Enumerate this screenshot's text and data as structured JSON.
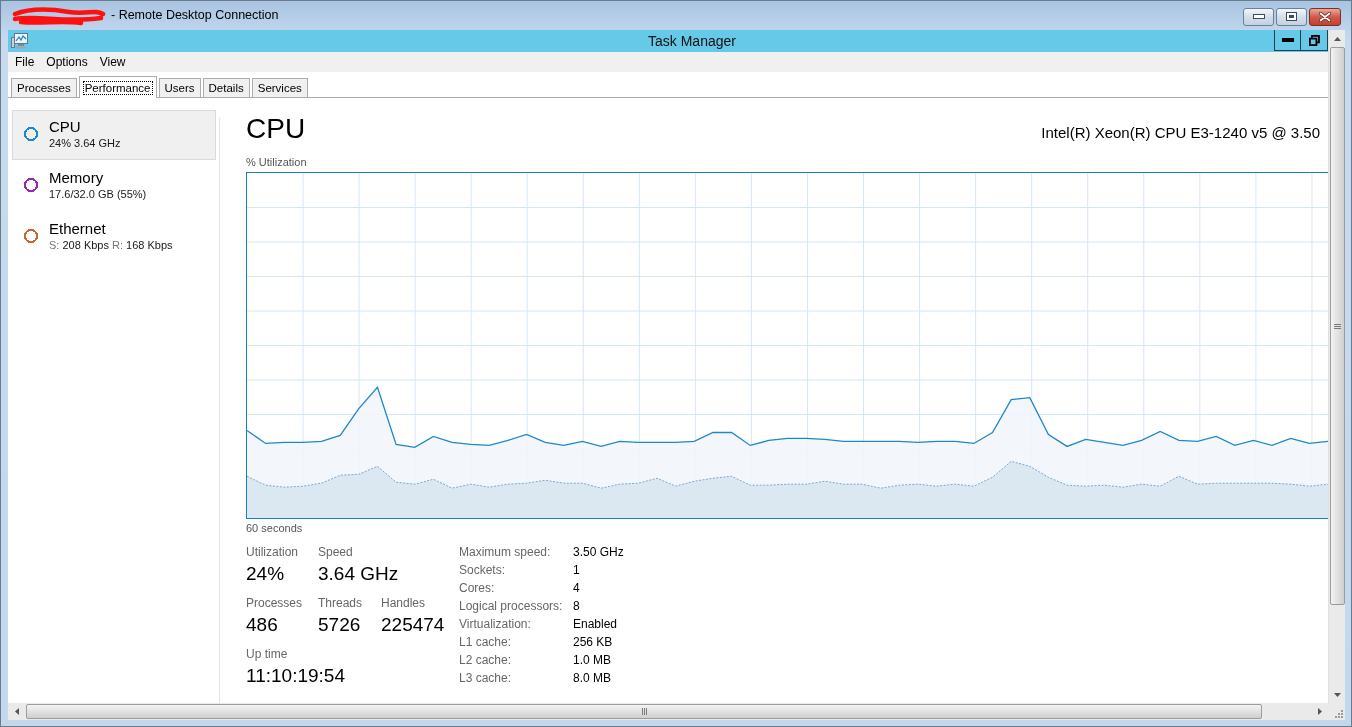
{
  "window": {
    "title": "- Remote Desktop Connection"
  },
  "app": {
    "title": "Task Manager"
  },
  "menu": [
    "File",
    "Options",
    "View"
  ],
  "tabs": [
    {
      "label": "Processes",
      "selected": false
    },
    {
      "label": "Performance",
      "selected": true
    },
    {
      "label": "Users",
      "selected": false
    },
    {
      "label": "Details",
      "selected": false
    },
    {
      "label": "Services",
      "selected": false
    }
  ],
  "sidebar": {
    "items": [
      {
        "name": "CPU",
        "reading": [
          {
            "value": "24% 3.64 GHz"
          }
        ],
        "selected": true,
        "color": "#1c88d4"
      },
      {
        "name": "Memory",
        "reading": [
          {
            "value": "17.6/32.0 GB (55%)"
          }
        ],
        "selected": false,
        "color": "#9a28ad"
      },
      {
        "name": "Ethernet",
        "reading": [
          {
            "label": "S:",
            "value": "208 Kbps"
          },
          {
            "label": "R:",
            "value": "168 Kbps"
          }
        ],
        "selected": false,
        "color": "#c9692b"
      }
    ]
  },
  "panel": {
    "title": "CPU",
    "processor": "Intel(R) Xeon(R) CPU E3-1240 v5 @ 3.50",
    "graph": {
      "label": "% Utilization",
      "time_span": "60 seconds"
    },
    "stat_rows": [
      [
        {
          "label": "Utilization",
          "value": "24%"
        },
        {
          "label": "Speed",
          "value": "3.64 GHz"
        }
      ],
      [
        {
          "label": "Processes",
          "value": "486"
        },
        {
          "label": "Threads",
          "value": "5726"
        },
        {
          "label": "Handles",
          "value": "225474"
        }
      ],
      [
        {
          "label": "Up time",
          "value": "11:10:19:54"
        }
      ]
    ],
    "details": [
      {
        "label": "Maximum speed:",
        "value": "3.50 GHz"
      },
      {
        "label": "Sockets:",
        "value": "1"
      },
      {
        "label": "Cores:",
        "value": "4"
      },
      {
        "label": "Logical processors:",
        "value": "8"
      },
      {
        "label": "Virtualization:",
        "value": "Enabled"
      },
      {
        "label": "L1 cache:",
        "value": "256 KB"
      },
      {
        "label": "L2 cache:",
        "value": "1.0 MB"
      },
      {
        "label": "L3 cache:",
        "value": "8.0 MB"
      }
    ]
  }
}
